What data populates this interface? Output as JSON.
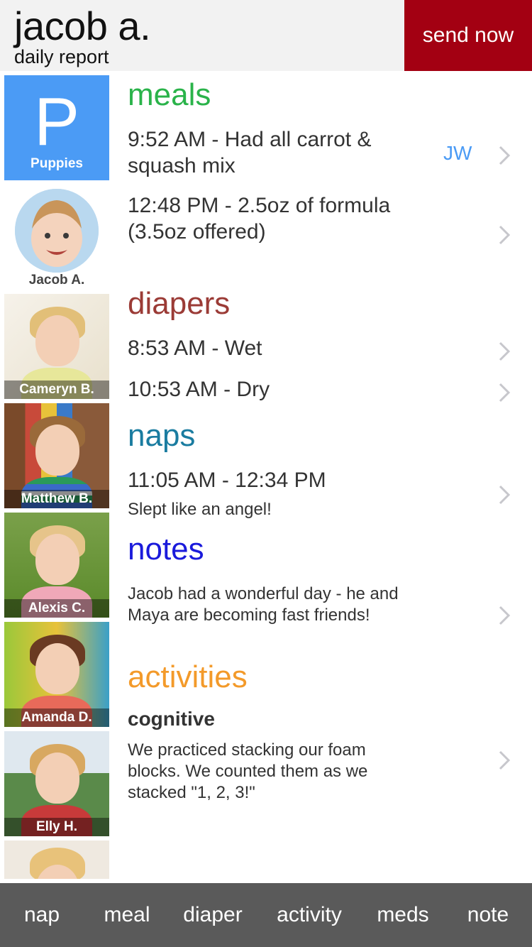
{
  "header": {
    "child_name": "jacob a.",
    "subtitle": "daily report",
    "send_label": "send now"
  },
  "sidebar": {
    "room": {
      "letter": "P",
      "label": "Puppies"
    },
    "selected_child": "Jacob A.",
    "children": [
      "Cameryn B.",
      "Matthew B.",
      "Alexis C.",
      "Amanda D.",
      "Elly H."
    ]
  },
  "sections": {
    "meals": {
      "title": "meals",
      "color": "#2ab34a",
      "entries": [
        {
          "text": "9:52 AM - Had all carrot & squash mix",
          "initials": "JW"
        },
        {
          "text": "12:48 PM - 2.5oz of formula (3.5oz offered)"
        }
      ]
    },
    "diapers": {
      "title": "diapers",
      "color": "#9b3b36",
      "entries": [
        {
          "text": "8:53 AM - Wet"
        },
        {
          "text": "10:53 AM - Dry"
        }
      ]
    },
    "naps": {
      "title": "naps",
      "color": "#1a7ca0",
      "entries": [
        {
          "text": "11:05 AM - 12:34 PM",
          "note": "Slept like an angel!"
        }
      ]
    },
    "notes": {
      "title": "notes",
      "color": "#1a1adb",
      "entries": [
        {
          "text": "Jacob had a wonderful day - he and Maya are becoming fast friends!"
        }
      ]
    },
    "activities": {
      "title": "activities",
      "color": "#f39a2a",
      "entries": [
        {
          "category": "cognitive",
          "text": "We practiced stacking our foam blocks. We counted them as we stacked \"1, 2, 3!\""
        }
      ]
    }
  },
  "bottom_bar": {
    "items": [
      "nap",
      "meal",
      "diaper",
      "activity",
      "meds",
      "note"
    ]
  },
  "colors": {
    "header_bg": "#f2f2f2",
    "send_button": "#a30012",
    "room_tile": "#4b9bf5",
    "bottom_bar": "#5a5a5a",
    "chevron": "#c7c7cc",
    "initials": "#4b9bf5"
  }
}
